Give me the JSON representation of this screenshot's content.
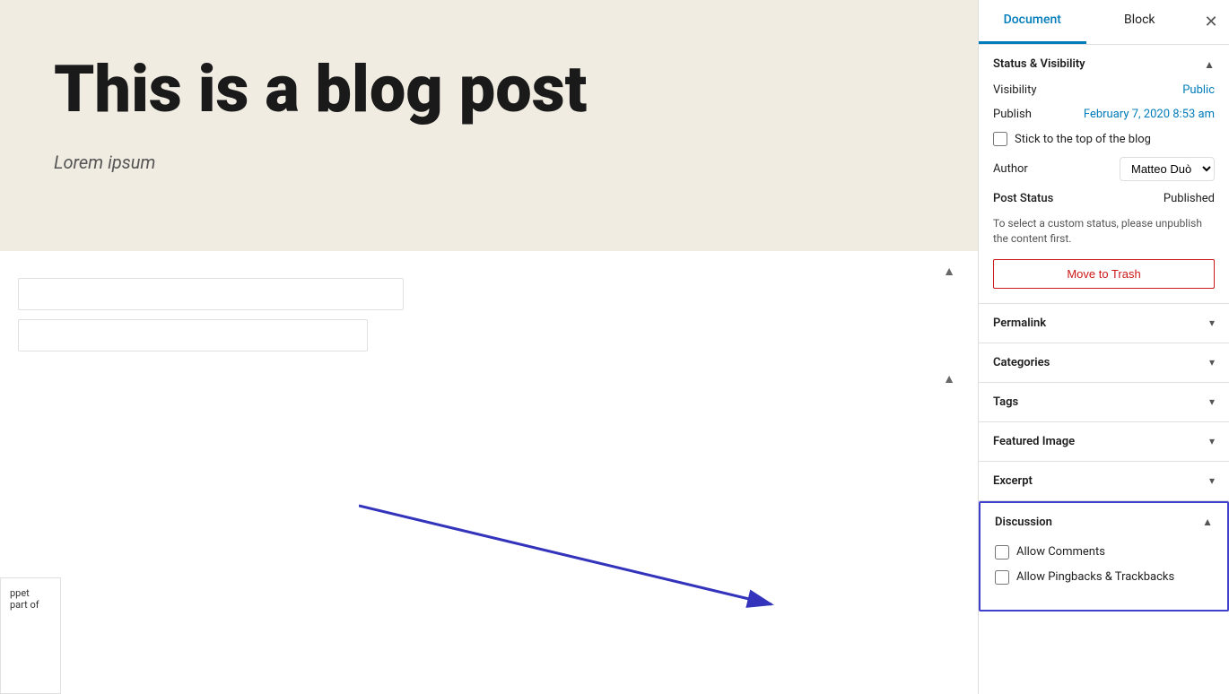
{
  "tabs": {
    "document_label": "Document",
    "block_label": "Block",
    "close_icon": "✕"
  },
  "post": {
    "title": "This is a blog post",
    "subtitle": "Lorem ipsum"
  },
  "sidebar": {
    "status_visibility": {
      "title": "Status & Visibility",
      "visibility_label": "Visibility",
      "visibility_value": "Public",
      "publish_label": "Publish",
      "publish_value": "February 7, 2020 8:53 am",
      "stick_to_top_label": "Stick to the top of the blog",
      "stick_to_top_checked": false,
      "author_label": "Author",
      "author_value": "Matteo Duò",
      "post_status_label": "Post Status",
      "post_status_value": "Published",
      "status_note": "To select a custom status, please unpublish the content first.",
      "move_to_trash_label": "Move to Trash"
    },
    "permalink": {
      "title": "Permalink"
    },
    "categories": {
      "title": "Categories"
    },
    "tags": {
      "title": "Tags"
    },
    "featured_image": {
      "title": "Featured Image"
    },
    "excerpt": {
      "title": "Excerpt"
    },
    "discussion": {
      "title": "Discussion",
      "allow_comments_label": "Allow Comments",
      "allow_comments_checked": false,
      "allow_pingbacks_label": "Allow Pingbacks & Trackbacks",
      "allow_pingbacks_checked": false
    }
  }
}
